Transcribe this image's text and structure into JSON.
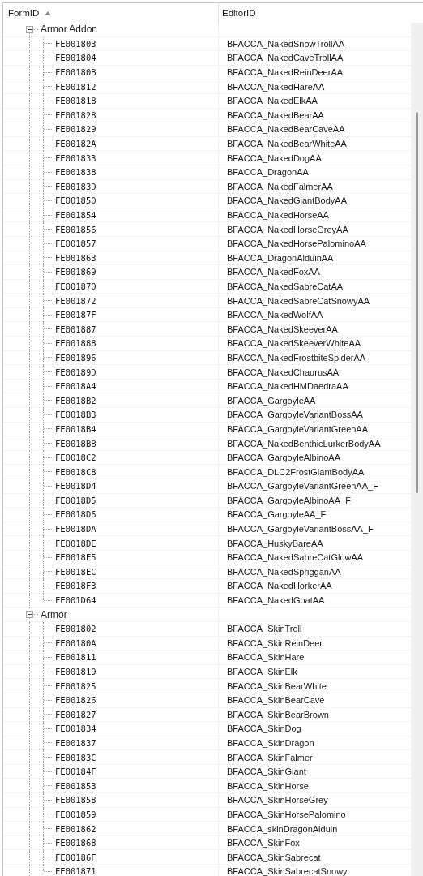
{
  "columns": [
    {
      "label": "FormID",
      "sorted": true
    },
    {
      "label": "EditorID",
      "sorted": false
    }
  ],
  "groups": [
    {
      "label": "Armor Addon",
      "expanded": true,
      "children": [
        {
          "form_id": "FE001803",
          "editor_id": "BFACCA_NakedSnowTrollAA"
        },
        {
          "form_id": "FE001804",
          "editor_id": "BFACCA_NakedCaveTrollAA"
        },
        {
          "form_id": "FE00180B",
          "editor_id": "BFACCA_NakedReinDeerAA"
        },
        {
          "form_id": "FE001812",
          "editor_id": "BFACCA_NakedHareAA"
        },
        {
          "form_id": "FE001818",
          "editor_id": "BFACCA_NakedElkAA"
        },
        {
          "form_id": "FE001828",
          "editor_id": "BFACCA_NakedBearAA"
        },
        {
          "form_id": "FE001829",
          "editor_id": "BFACCA_NakedBearCaveAA"
        },
        {
          "form_id": "FE00182A",
          "editor_id": "BFACCA_NakedBearWhiteAA"
        },
        {
          "form_id": "FE001833",
          "editor_id": "BFACCA_NakedDogAA"
        },
        {
          "form_id": "FE001838",
          "editor_id": "BFACCA_DragonAA"
        },
        {
          "form_id": "FE00183D",
          "editor_id": "BFACCA_NakedFalmerAA"
        },
        {
          "form_id": "FE001850",
          "editor_id": "BFACCA_NakedGiantBodyAA"
        },
        {
          "form_id": "FE001854",
          "editor_id": "BFACCA_NakedHorseAA"
        },
        {
          "form_id": "FE001856",
          "editor_id": "BFACCA_NakedHorseGreyAA"
        },
        {
          "form_id": "FE001857",
          "editor_id": "BFACCA_NakedHorsePalominoAA"
        },
        {
          "form_id": "FE001863",
          "editor_id": "BFACCA_DragonAlduinAA"
        },
        {
          "form_id": "FE001869",
          "editor_id": "BFACCA_NakedFoxAA"
        },
        {
          "form_id": "FE001870",
          "editor_id": "BFACCA_NakedSabreCatAA"
        },
        {
          "form_id": "FE001872",
          "editor_id": "BFACCA_NakedSabreCatSnowyAA"
        },
        {
          "form_id": "FE00187F",
          "editor_id": "BFACCA_NakedWolfAA"
        },
        {
          "form_id": "FE001887",
          "editor_id": "BFACCA_NakedSkeeverAA"
        },
        {
          "form_id": "FE001888",
          "editor_id": "BFACCA_NakedSkeeverWhiteAA"
        },
        {
          "form_id": "FE001896",
          "editor_id": "BFACCA_NakedFrostbiteSpiderAA"
        },
        {
          "form_id": "FE00189D",
          "editor_id": "BFACCA_NakedChaurusAA"
        },
        {
          "form_id": "FE0018A4",
          "editor_id": "BFACCA_NakedHMDaedraAA"
        },
        {
          "form_id": "FE0018B2",
          "editor_id": "BFACCA_GargoyleAA"
        },
        {
          "form_id": "FE0018B3",
          "editor_id": "BFACCA_GargoyleVariantBossAA"
        },
        {
          "form_id": "FE0018B4",
          "editor_id": "BFACCA_GargoyleVariantGreenAA"
        },
        {
          "form_id": "FE0018BB",
          "editor_id": "BFACCA_NakedBenthicLurkerBodyAA"
        },
        {
          "form_id": "FE0018C2",
          "editor_id": "BFACCA_GargoyleAlbinoAA"
        },
        {
          "form_id": "FE0018C8",
          "editor_id": "BFACCA_DLC2FrostGiantBodyAA"
        },
        {
          "form_id": "FE0018D4",
          "editor_id": "BFACCA_GargoyleVariantGreenAA_F"
        },
        {
          "form_id": "FE0018D5",
          "editor_id": "BFACCA_GargoyleAlbinoAA_F"
        },
        {
          "form_id": "FE0018D6",
          "editor_id": "BFACCA_GargoyleAA_F"
        },
        {
          "form_id": "FE0018DA",
          "editor_id": "BFACCA_GargoyleVariantBossAA_F"
        },
        {
          "form_id": "FE0018DE",
          "editor_id": "BFACCA_HuskyBareAA"
        },
        {
          "form_id": "FE0018E5",
          "editor_id": "BFACCA_NakedSabreCatGlowAA"
        },
        {
          "form_id": "FE0018EC",
          "editor_id": "BFACCA_NakedSprigganAA"
        },
        {
          "form_id": "FE0018F3",
          "editor_id": "BFACCA_NakedHorkerAA"
        },
        {
          "form_id": "FE001D64",
          "editor_id": "BFACCA_NakedGoatAA"
        }
      ]
    },
    {
      "label": "Armor",
      "expanded": true,
      "children": [
        {
          "form_id": "FE001802",
          "editor_id": "BFACCA_SkinTroll"
        },
        {
          "form_id": "FE00180A",
          "editor_id": "BFACCA_SkinReinDeer"
        },
        {
          "form_id": "FE001811",
          "editor_id": "BFACCA_SkinHare"
        },
        {
          "form_id": "FE001819",
          "editor_id": "BFACCA_SkinElk"
        },
        {
          "form_id": "FE001825",
          "editor_id": "BFACCA_SkinBearWhite"
        },
        {
          "form_id": "FE001826",
          "editor_id": "BFACCA_SkinBearCave"
        },
        {
          "form_id": "FE001827",
          "editor_id": "BFACCA_SkinBearBrown"
        },
        {
          "form_id": "FE001834",
          "editor_id": "BFACCA_SkinDog"
        },
        {
          "form_id": "FE001837",
          "editor_id": "BFACCA_SkinDragon"
        },
        {
          "form_id": "FE00183C",
          "editor_id": "BFACCA_SkinFalmer"
        },
        {
          "form_id": "FE00184F",
          "editor_id": "BFACCA_SkinGiant"
        },
        {
          "form_id": "FE001853",
          "editor_id": "BFACCA_SkinHorse"
        },
        {
          "form_id": "FE001858",
          "editor_id": "BFACCA_SkinHorseGrey"
        },
        {
          "form_id": "FE001859",
          "editor_id": "BFACCA_SkinHorsePalomino"
        },
        {
          "form_id": "FE001862",
          "editor_id": "BFACCA_skinDragonAlduin"
        },
        {
          "form_id": "FE001868",
          "editor_id": "BFACCA_SkinFox"
        },
        {
          "form_id": "FE00186F",
          "editor_id": "BFACCA_SkinSabrecat"
        },
        {
          "form_id": "FE001871",
          "editor_id": "BFACCA_SkinSabrecatSnowy"
        }
      ]
    }
  ]
}
